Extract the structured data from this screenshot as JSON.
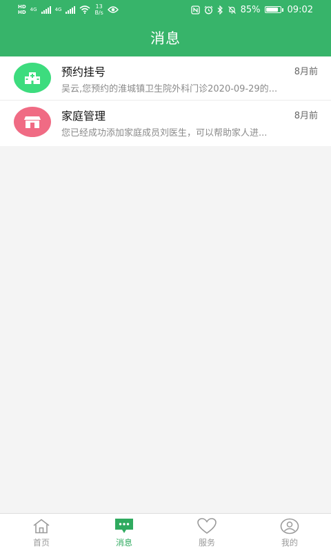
{
  "status_bar": {
    "hd_top": "HD",
    "hd_bottom": "HD",
    "net1": "4G",
    "net2": "4G",
    "speed_value": "13",
    "speed_unit": "B/s",
    "battery_percent": "85%",
    "battery_level": 0.85,
    "time": "09:02"
  },
  "header": {
    "title": "消息"
  },
  "messages": [
    {
      "title": "预约挂号",
      "time": "8月前",
      "preview": "吴云,您预约的淮城镇卫生院外科门诊2020-09-29的...",
      "icon": "hospital-icon",
      "color": "#3ddc7e"
    },
    {
      "title": "家庭管理",
      "time": "8月前",
      "preview": "您已经成功添加家庭成员刘医生，可以帮助家人进...",
      "icon": "house-icon",
      "color": "#f06b84"
    }
  ],
  "tabs": [
    {
      "label": "首页",
      "icon": "home-icon",
      "active": false
    },
    {
      "label": "消息",
      "icon": "message-icon",
      "active": true
    },
    {
      "label": "服务",
      "icon": "heart-icon",
      "active": false
    },
    {
      "label": "我的",
      "icon": "user-icon",
      "active": false
    }
  ],
  "colors": {
    "brand": "#37b46a",
    "active_tab": "#2faa5f",
    "inactive_tab": "#9a9a9a",
    "background": "#f4f4f4"
  }
}
